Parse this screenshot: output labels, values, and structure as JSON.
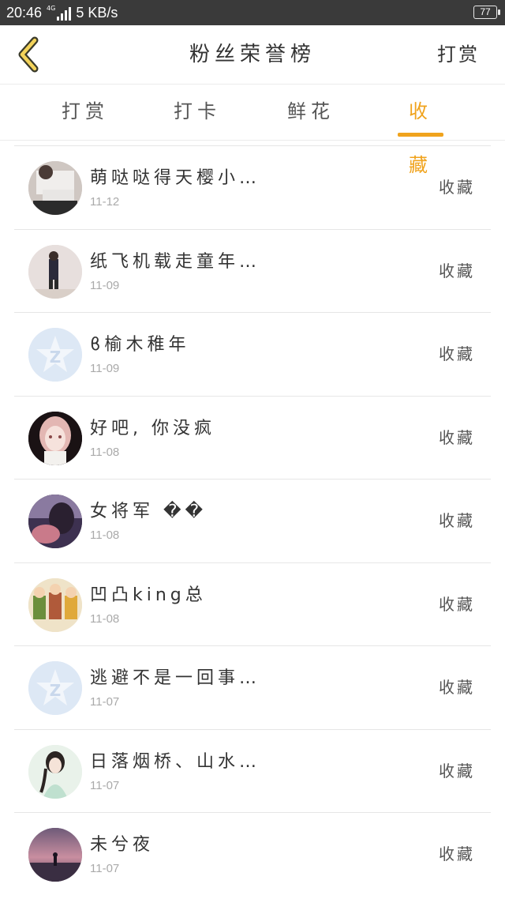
{
  "status_bar": {
    "time": "20:46",
    "network": "4G",
    "speed": "5 KB/s",
    "battery": "77"
  },
  "header": {
    "back_icon": "chevron-left-icon",
    "title": "粉丝荣誉榜",
    "right_action": "打赏"
  },
  "tabs": [
    {
      "label": "打赏",
      "active": false
    },
    {
      "label": "打卡",
      "active": false
    },
    {
      "label": "鲜花",
      "active": false
    },
    {
      "label": "收藏",
      "active": true
    }
  ],
  "colors": {
    "accent": "#f0a31d",
    "status_bar": "#3a3a3a",
    "text": "#333333",
    "subtext": "#aaaaaa"
  },
  "list": [
    {
      "name": "萌哒哒得天樱小…",
      "date": "11-12",
      "action": "收藏",
      "avatar": "photo-girl"
    },
    {
      "name": "纸飞机载走童年…",
      "date": "11-09",
      "action": "收藏",
      "avatar": "photo-boys"
    },
    {
      "name": "ϐ榆木稚年",
      "date": "11-09",
      "action": "收藏",
      "avatar": "default-qq"
    },
    {
      "name": "好吧, 你没疯",
      "date": "11-08",
      "action": "收藏",
      "avatar": "anime-girl"
    },
    {
      "name": "女将军 ��",
      "date": "11-08",
      "action": "收藏",
      "avatar": "photo-purple"
    },
    {
      "name": "凹凸king总",
      "date": "11-08",
      "action": "收藏",
      "avatar": "cartoon-group"
    },
    {
      "name": "逃避不是一回事…",
      "date": "11-07",
      "action": "收藏",
      "avatar": "default-qq"
    },
    {
      "name": "日落烟桥、山水…",
      "date": "11-07",
      "action": "收藏",
      "avatar": "anime-lady"
    },
    {
      "name": "未兮夜",
      "date": "11-07",
      "action": "收藏",
      "avatar": "sunset"
    }
  ]
}
